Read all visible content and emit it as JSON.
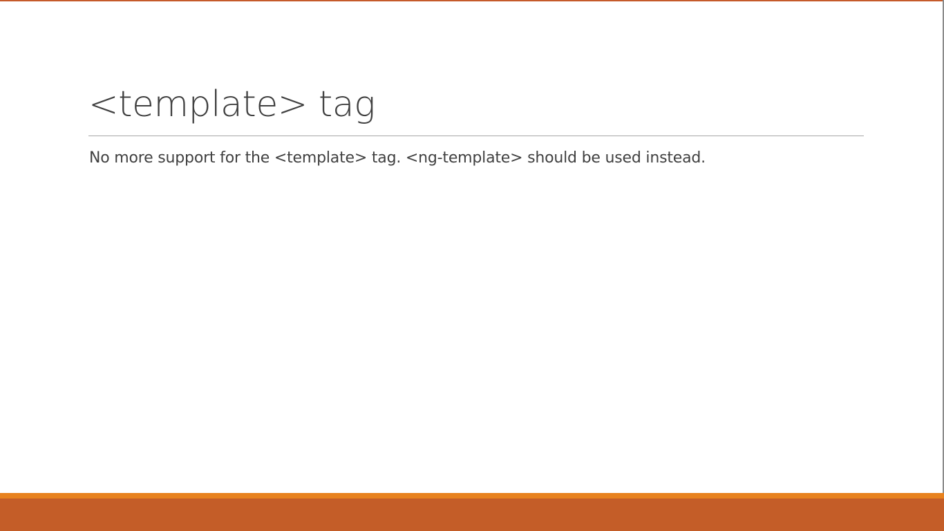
{
  "slide": {
    "title": "<template> tag",
    "body": "No more support for the <template> tag. <ng-template> should be used instead."
  },
  "colors": {
    "accent": "#e8821e",
    "footer": "#c45d28",
    "text": "#404040",
    "rule": "#a6a6a6"
  }
}
